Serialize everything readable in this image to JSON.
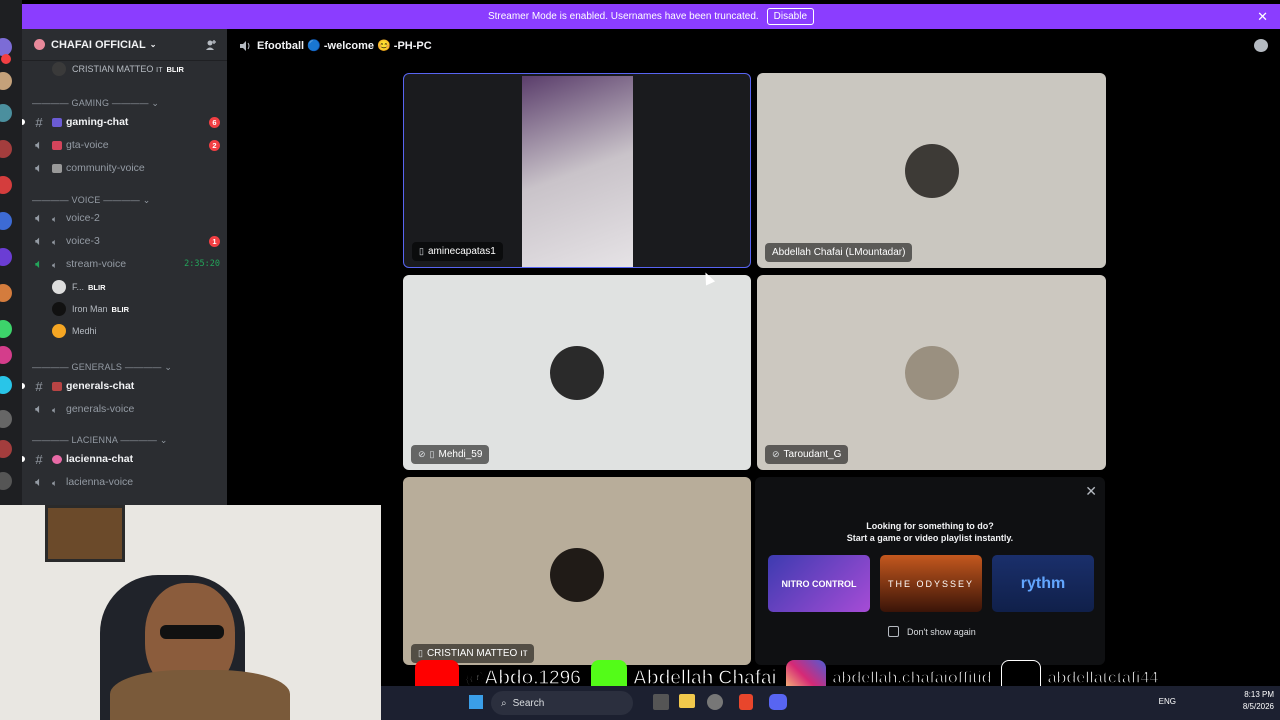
{
  "banner": {
    "text": "Streamer Mode is enabled. Usernames have been truncated.",
    "button": "Disable"
  },
  "server": {
    "name": "CHAFAI OFFICIAL",
    "top_member": "CRISTIAN MATTEO ıт",
    "top_member_role": "BLIR",
    "categories": {
      "gaming": "———— GAMING ————",
      "voice": "———— VOICE ————",
      "generals": "———— GENERALS ————",
      "lacienna": "———— LACIENNA ————"
    },
    "channels": [
      {
        "name": "gaming-chat",
        "type": "text",
        "badge": "6"
      },
      {
        "name": "gta-voice",
        "type": "voice",
        "badge": "2"
      },
      {
        "name": "community-voice",
        "type": "voice",
        "badge": ""
      },
      {
        "name": "voice-2",
        "type": "voice",
        "badge": ""
      },
      {
        "name": "voice-3",
        "type": "voice",
        "badge": "1"
      },
      {
        "name": "stream-voice",
        "type": "voice",
        "timer": "2:35:20"
      },
      {
        "name": "generals-chat",
        "type": "text",
        "badge": ""
      },
      {
        "name": "generals-voice",
        "type": "voice",
        "badge": ""
      },
      {
        "name": "lacienna-chat",
        "type": "text",
        "badge": ""
      },
      {
        "name": "lacienna-voice",
        "type": "voice",
        "badge": ""
      }
    ],
    "voice_members": [
      {
        "name": "F...",
        "role": "BLIR"
      },
      {
        "name": "Iron Man",
        "role": "BLIR"
      },
      {
        "name": "Medhi",
        "role": ""
      }
    ]
  },
  "voice_header": {
    "title": "Efootball 🔵 -welcome 😊 -PH-PC"
  },
  "participants": [
    {
      "name": "aminecapatas1"
    },
    {
      "name": "Abdellah Chafai (LMountadar)"
    },
    {
      "name": "Mehdi_59"
    },
    {
      "name": "Taroudant_G"
    },
    {
      "name": "CRISTIAN MATTEO ıт"
    }
  ],
  "activity": {
    "line1": "Looking for something to do?",
    "line2": "Start a game or video playlist instantly.",
    "cards": [
      "NITRO CONTROL",
      "THE ODYSSEY",
      "rythm"
    ],
    "dont_show": "Don't show again"
  },
  "overlay": {
    "youtube": "@Abdo.1296",
    "kick": "Abdellah Chafai",
    "instagram": "abdellah.chafaioffitid",
    "tiktok": "abdellatctafi44"
  },
  "taskbar": {
    "search": "Search",
    "lang": "ENG",
    "time": "8:13 PM",
    "date": "8/5/2026"
  },
  "colors": {
    "banner": "#8b3dff",
    "sidebar": "#2b2d31",
    "rail": "#1e1f22",
    "unread_badge": "#f23f43",
    "live_green": "#23a55a"
  }
}
